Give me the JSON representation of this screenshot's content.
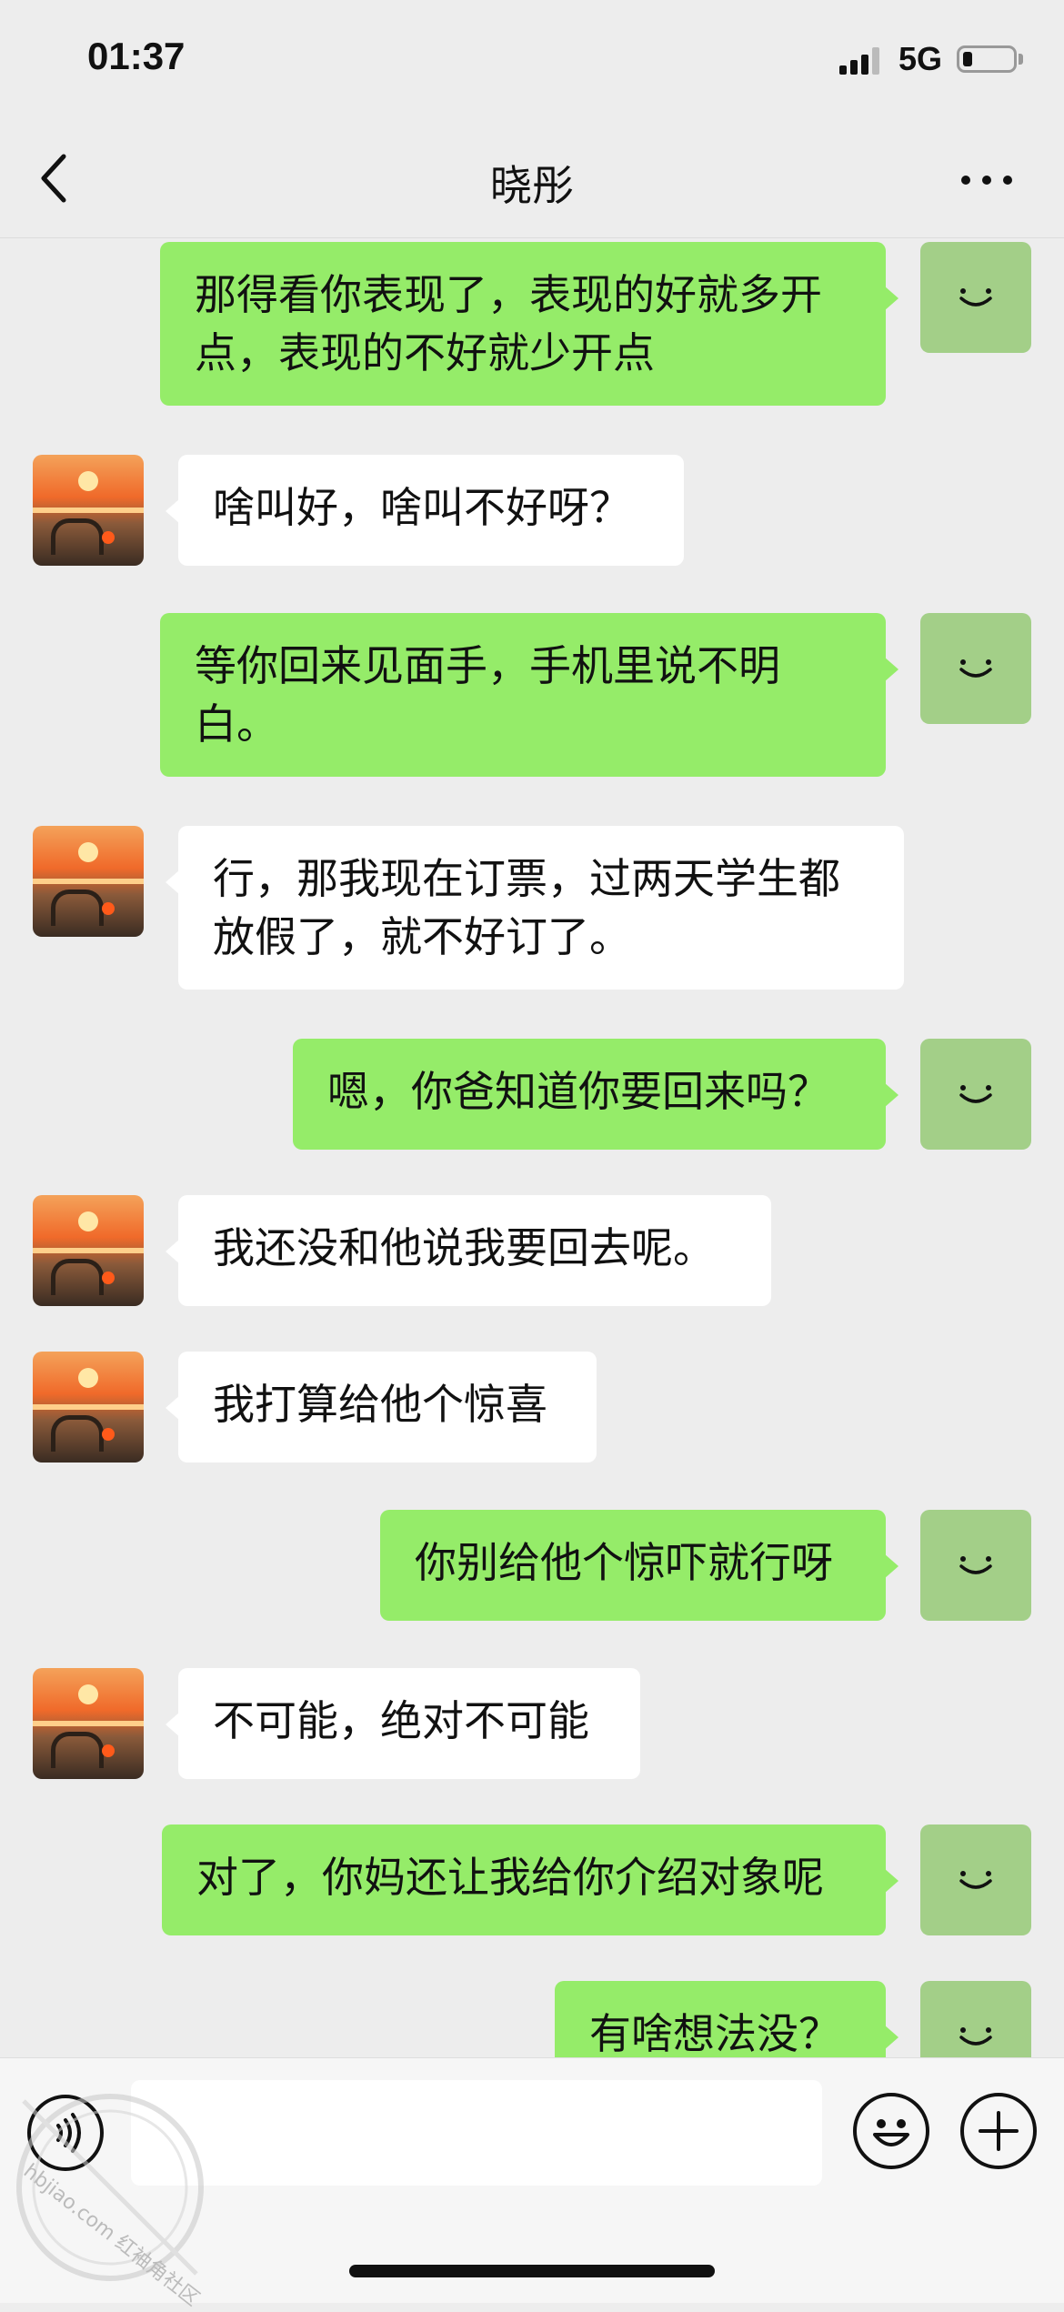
{
  "status_bar": {
    "time": "01:37",
    "network": "5G",
    "battery_level": 0.2
  },
  "nav": {
    "title": "晓彤",
    "back_icon": "chevron-left-icon",
    "more_icon": "more-dots-icon"
  },
  "colors": {
    "outgoing_bubble": "#95ec69",
    "incoming_bubble": "#ffffff",
    "background": "#ededed",
    "own_avatar": "#a3cf88"
  },
  "messages": [
    {
      "from": "me",
      "lines": [
        "那得看你表现了，表现的好就多开",
        "点，表现的不好就少开点"
      ]
    },
    {
      "from": "contact",
      "lines": [
        "啥叫好，啥叫不好呀？"
      ]
    },
    {
      "from": "me",
      "lines": [
        "等你回来见面手，手机里说不明",
        "白。"
      ]
    },
    {
      "from": "contact",
      "lines": [
        "行，那我现在订票，过两天学生都",
        "放假了，就不好订了。"
      ]
    },
    {
      "from": "me",
      "lines": [
        "嗯，你爸知道你要回来吗？"
      ]
    },
    {
      "from": "contact",
      "lines": [
        "我还没和他说我要回去呢。"
      ]
    },
    {
      "from": "contact",
      "lines": [
        "我打算给他个惊喜"
      ]
    },
    {
      "from": "me",
      "lines": [
        "你别给他个惊吓就行呀"
      ]
    },
    {
      "from": "contact",
      "lines": [
        "不可能，绝对不可能"
      ]
    },
    {
      "from": "me",
      "lines": [
        "对了，你妈还让我给你介绍对象呢"
      ]
    },
    {
      "from": "me",
      "lines": [
        "有啥想法没？"
      ]
    }
  ],
  "input_bar": {
    "voice_icon": "voice-icon",
    "emoji_icon": "emoji-icon",
    "plus_icon": "plus-icon",
    "message_value": ""
  },
  "watermark": {
    "text": "hbjiao.com 红袖角社区"
  }
}
